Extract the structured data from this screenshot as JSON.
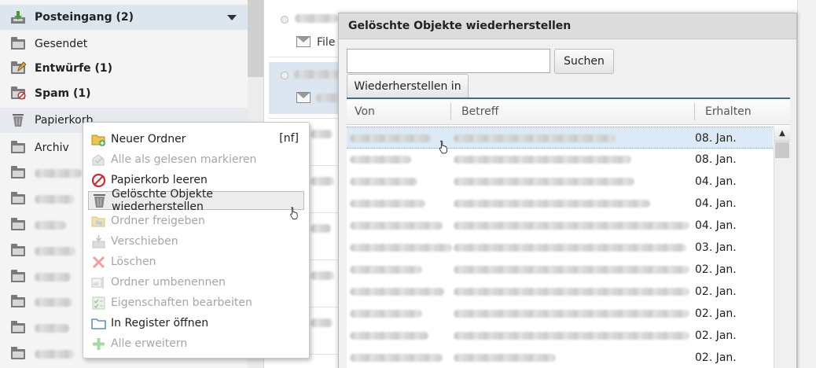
{
  "sidebar": {
    "folders": [
      {
        "label": "Posteingang (2)",
        "bold": true
      },
      {
        "label": "Gesendet",
        "bold": false
      },
      {
        "label": "Entwürfe (1)",
        "bold": true
      },
      {
        "label": "Spam (1)",
        "bold": true
      },
      {
        "label": "Papierkorb",
        "bold": false
      },
      {
        "label": "Archiv",
        "bold": false
      }
    ]
  },
  "maillist": {
    "row1_text": "File"
  },
  "context_menu": {
    "items": [
      {
        "label": "Neuer Ordner",
        "shortcut": "[nf]",
        "icon": "new-folder-icon",
        "enabled": true
      },
      {
        "label": "Alle als gelesen markieren",
        "icon": "mark-read-icon",
        "enabled": false
      },
      {
        "label": "Papierkorb leeren",
        "icon": "no-entry-icon",
        "enabled": true
      },
      {
        "label": "Gelöschte Objekte wiederherstellen",
        "icon": "trash-icon",
        "enabled": true
      },
      {
        "label": "Ordner freigeben",
        "icon": "share-folder-icon",
        "enabled": false
      },
      {
        "label": "Verschieben",
        "icon": "move-icon",
        "enabled": false
      },
      {
        "label": "Löschen",
        "icon": "delete-x-icon",
        "enabled": false
      },
      {
        "label": "Ordner umbenennen",
        "icon": "rename-icon",
        "enabled": false
      },
      {
        "label": "Eigenschaften bearbeiten",
        "icon": "properties-icon",
        "enabled": false
      },
      {
        "label": "In Register öffnen",
        "icon": "open-tab-icon",
        "enabled": true
      },
      {
        "label": "Alle erweitern",
        "icon": "expand-plus-icon",
        "enabled": false
      }
    ]
  },
  "dialog": {
    "title": "Gelöschte Objekte wiederherstellen",
    "search_value": "",
    "search_button": "Suchen",
    "restore_in_button": "Wiederherstellen in",
    "columns": {
      "from": "Von",
      "subject": "Betreff",
      "received": "Erhalten"
    },
    "rows": [
      {
        "received": "08. Jan."
      },
      {
        "received": "08. Jan."
      },
      {
        "received": "04. Jan."
      },
      {
        "received": "04. Jan."
      },
      {
        "received": "04. Jan."
      },
      {
        "received": "03. Jan."
      },
      {
        "received": "02. Jan."
      },
      {
        "received": "02. Jan."
      },
      {
        "received": "02. Jan."
      },
      {
        "received": "02. Jan."
      },
      {
        "received": "02. Jan."
      }
    ]
  },
  "colors": {
    "selected_folder_bg": "#dde6ef",
    "grid_header_accent": "#3d6b9a",
    "selected_row_bg": "#dce9f6"
  }
}
